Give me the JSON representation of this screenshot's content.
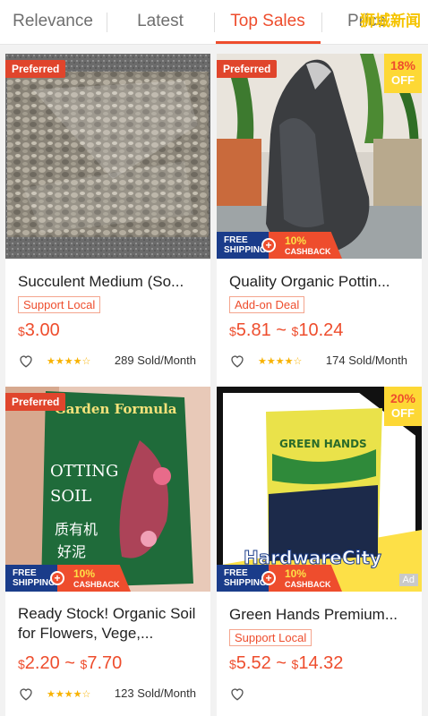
{
  "tabs": [
    {
      "label": "Relevance"
    },
    {
      "label": "Latest"
    },
    {
      "label": "Top Sales",
      "active": true
    },
    {
      "label": "Price"
    }
  ],
  "watermark": "狮城新闻",
  "accent_color": "#ee4d2d",
  "products": [
    {
      "title": "Succulent Medium (So...",
      "preferred": "Preferred",
      "tag": "Support Local",
      "currency": "$",
      "price": "3.00",
      "sold": "289 Sold/Month",
      "rating_icon": "star-rating-4.5"
    },
    {
      "title": "Quality Organic Pottin...",
      "preferred": "Preferred",
      "discount_pct": "18%",
      "discount_off": "OFF",
      "promo_free": "FREE",
      "promo_shipping": "SHIPPING",
      "promo_amount": "10%",
      "promo_cashback": "CASHBACK",
      "tag": "Add-on Deal",
      "currency": "$",
      "price_low": "5.81",
      "price_sep": "~",
      "price_high": "10.24",
      "sold": "174 Sold/Month"
    },
    {
      "title": "Ready Stock! Organic Soil for Flowers, Vege,...",
      "preferred": "Preferred",
      "bag_title": "Garden Formula",
      "bag_label": "POTTING SOIL",
      "promo_free": "FREE",
      "promo_shipping": "SHIPPING",
      "promo_amount": "10%",
      "promo_cashback": "CASHBACK",
      "currency": "$",
      "price_low": "2.20",
      "price_sep": "~",
      "price_high": "7.70",
      "sold": "123 Sold/Month"
    },
    {
      "title": "Green Hands Premium...",
      "discount_pct": "20%",
      "discount_off": "OFF",
      "bag_title": "GREEN HANDS",
      "brand_text": "HardwareCity",
      "promo_free": "FREE",
      "promo_shipping": "SHIPPING",
      "promo_amount": "10%",
      "promo_cashback": "CASHBACK",
      "ad": "Ad",
      "tag": "Support Local",
      "currency": "$",
      "price_low": "5.52",
      "price_sep": "~",
      "price_high": "14.32"
    }
  ]
}
